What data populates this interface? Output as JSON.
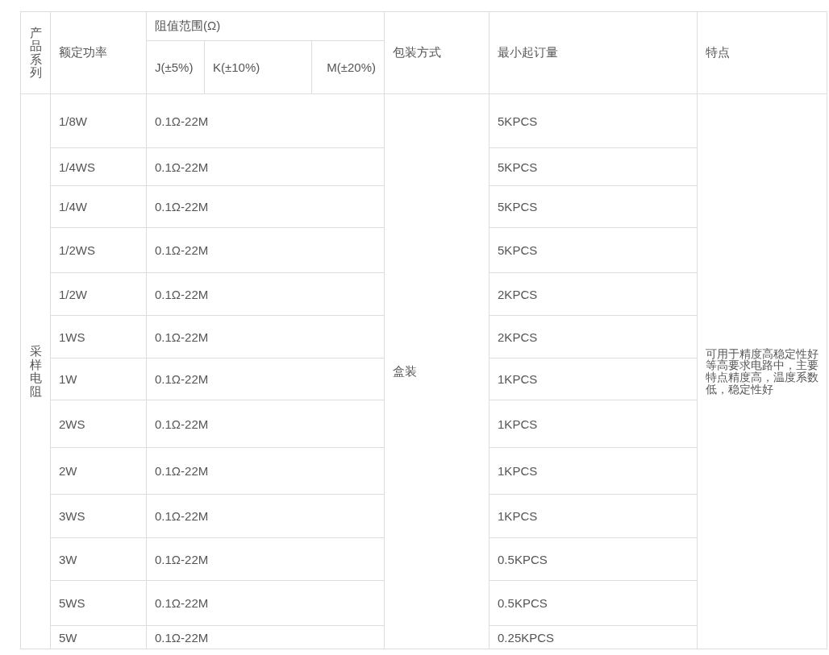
{
  "table": {
    "header": {
      "series": "产品系列",
      "power": "额定功率",
      "range": "阻值范围(Ω)",
      "tolerances": [
        "J(±5%)",
        "K(±10%)",
        "M(±20%)"
      ],
      "packaging": "包装方式",
      "min_order": "最小起订量",
      "features": "特点"
    },
    "series": "采样电阻",
    "packaging": "盒装",
    "features": "可用于精度高稳定性好等高要求电路中，主要特点精度高，温度系数低，稳定性好",
    "rows": [
      {
        "power": "1/8W",
        "range": "0.1Ω-22M",
        "min_order": "5KPCS"
      },
      {
        "power": "1/4WS",
        "range": "0.1Ω-22M",
        "min_order": "5KPCS"
      },
      {
        "power": "1/4W",
        "range": "0.1Ω-22M",
        "min_order": "5KPCS"
      },
      {
        "power": "1/2WS",
        "range": "0.1Ω-22M",
        "min_order": "5KPCS"
      },
      {
        "power": "1/2W",
        "range": "0.1Ω-22M",
        "min_order": "2KPCS"
      },
      {
        "power": "1WS",
        "range": "0.1Ω-22M",
        "min_order": "2KPCS"
      },
      {
        "power": "1W",
        "range": "0.1Ω-22M",
        "min_order": "1KPCS"
      },
      {
        "power": "2WS",
        "range": "0.1Ω-22M",
        "min_order": "1KPCS"
      },
      {
        "power": "2W",
        "range": "0.1Ω-22M",
        "min_order": "1KPCS"
      },
      {
        "power": "3WS",
        "range": "0.1Ω-22M",
        "min_order": "1KPCS"
      },
      {
        "power": "3W",
        "range": "0.1Ω-22M",
        "min_order": "0.5KPCS"
      },
      {
        "power": "5WS",
        "range": "0.1Ω-22M",
        "min_order": "0.5KPCS"
      },
      {
        "power": "5W",
        "range": "0.1Ω-22M",
        "min_order": "0.25KPCS"
      }
    ]
  }
}
